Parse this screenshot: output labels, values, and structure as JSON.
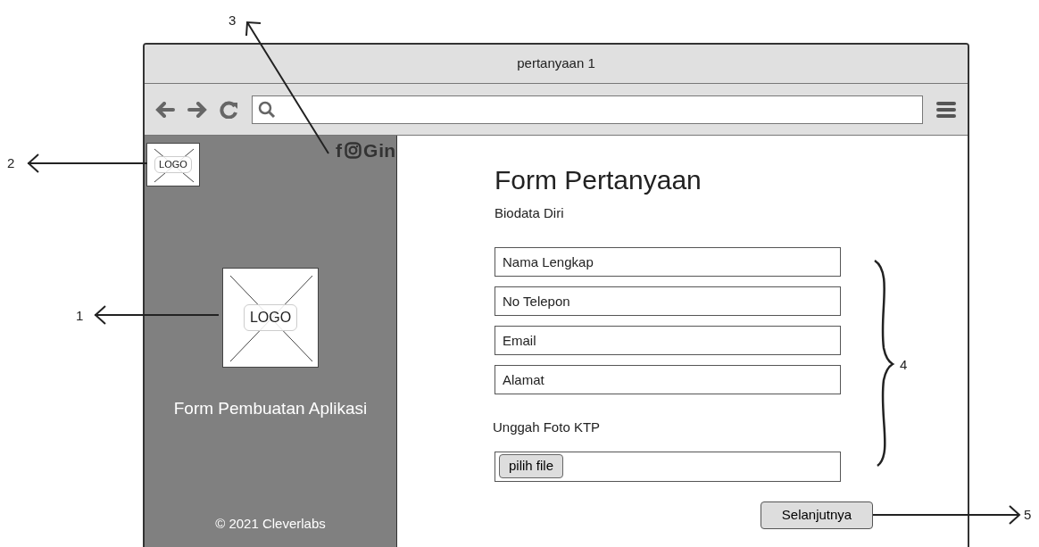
{
  "window": {
    "title": "pertanyaan 1"
  },
  "sidebar": {
    "logo_small": "LOGO",
    "social": [
      {
        "kind": "text",
        "label": "f"
      },
      {
        "kind": "instagram"
      },
      {
        "kind": "text",
        "label": "G"
      },
      {
        "kind": "text",
        "label": "in"
      }
    ],
    "logo_large": "LOGO",
    "app_title": "Form Pembuatan Aplikasi",
    "footer": "© 2021 Cleverlabs"
  },
  "form": {
    "title": "Form Pertanyaan",
    "subtitle": "Biodata Diri",
    "fields": [
      {
        "placeholder": "Nama Lengkap"
      },
      {
        "placeholder": "No Telepon"
      },
      {
        "placeholder": "Email"
      },
      {
        "placeholder": "Alamat"
      }
    ],
    "upload_label": "Unggah Foto KTP",
    "upload_button": "pilih file",
    "submit": "Selanjutnya"
  },
  "annotations": [
    "1",
    "2",
    "3",
    "4",
    "5"
  ]
}
